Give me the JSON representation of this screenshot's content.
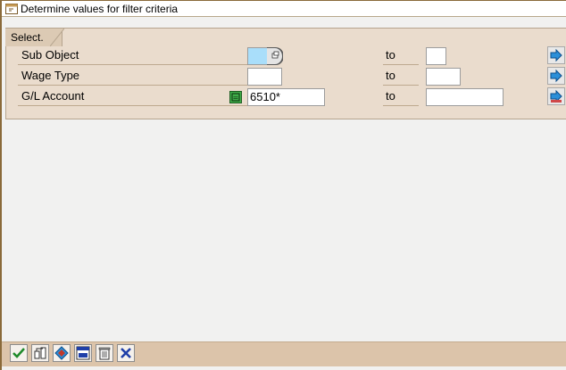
{
  "window": {
    "title": "Determine values for filter criteria",
    "title_icon": "dialog-icon"
  },
  "selection_group": {
    "title": "Select."
  },
  "rows": [
    {
      "label": "Sub Object",
      "low_value": "",
      "to_label": "to",
      "high_value": ""
    },
    {
      "label": "Wage Type",
      "low_value": "",
      "to_label": "to",
      "high_value": ""
    },
    {
      "label": "G/L Account",
      "low_value": "6510*",
      "to_label": "to",
      "high_value": ""
    }
  ],
  "toolbar": {
    "buttons": [
      "execute-check-icon",
      "multiple-selection-icon",
      "options-icon",
      "save-variant-icon",
      "delete-icon",
      "cancel-icon"
    ]
  },
  "colors": {
    "group_bg": "#eadccd",
    "required_field": "#a9defa",
    "toolbar_bg": "#dcc4aa",
    "accent_blue": "#1f5fd6"
  }
}
